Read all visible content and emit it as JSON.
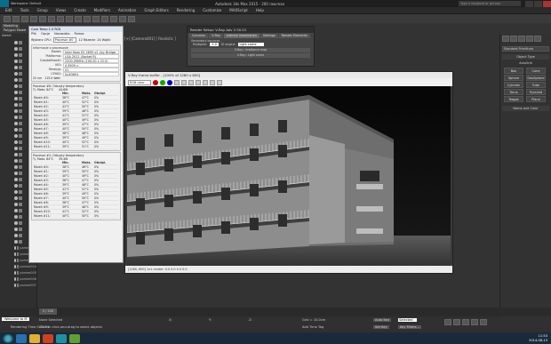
{
  "window": {
    "title": "Autodesk 3ds Max 2015 - 200  raw.max",
    "workspace": "Workspace: Default",
    "search_placeholder": "Type a keyword or phrase"
  },
  "menu": [
    "Edit",
    "Tools",
    "Group",
    "Views",
    "Create",
    "Modifiers",
    "Animation",
    "Graph Editors",
    "Rendering",
    "Customize",
    "MAXScript",
    "Help"
  ],
  "ribbon": {
    "tabs": [
      "Modeling",
      "Polygon Model"
    ],
    "select_label": "Select"
  },
  "viewport": {
    "label": "[+] [Camera001] [ Realistic ]"
  },
  "scene_objects": [
    "pamee001",
    "pamee002",
    "pamee003",
    "pamee004",
    "pamee005",
    "pamee006",
    "pamee007"
  ],
  "command_panel": {
    "dropdown": "Standard Primitives",
    "object_type": "Object Type",
    "autogrid": "AutoGrid",
    "buttons": [
      "Box",
      "Cone",
      "Sphere",
      "GeoSphere",
      "Cylinder",
      "Tube",
      "Torus",
      "Pyramid",
      "Teapot",
      "Plane"
    ],
    "name_color": "Name and Color"
  },
  "coretemp": {
    "title": "Core Temp 1.0 RC6",
    "menu": [
      "Plik",
      "Opcje",
      "Narzędzia",
      "Pomoc"
    ],
    "cpu_label": "Wybierz CPU:",
    "cpu_value": "Procesor #0",
    "cores": "12 Rdzenie",
    "threads": "24 Wątki",
    "info_header": "Informacje o procesorze",
    "fields": [
      {
        "k": "Model:",
        "v": "Intel Xeon E5 2695 v2 (Ivy Bridge-EP)"
      },
      {
        "k": "Platforma:",
        "v": "LGA 2011 (Socket R)"
      },
      {
        "k": "Częstotliwość:",
        "v": "2200.09MHz (100.00 x 22.0)"
      },
      {
        "k": "VID:",
        "v": "0.9509 v"
      },
      {
        "k": "Rewizja:",
        "v": "S1"
      },
      {
        "k": "CPUID:",
        "v": "0x306E4"
      }
    ],
    "lithography": "22 nm",
    "tdp": "115.0 Watt",
    "proc0": {
      "header": "Procesor #0: Odczyty temperatury",
      "tjmax": "Tj. Maks: 84°C",
      "power": "44.6W",
      "cols": [
        "",
        "Min.",
        "Maks.",
        "Obciąż."
      ],
      "rows": [
        [
          "Rdzeń #0:",
          "38°C",
          "47°C",
          "0%"
        ],
        [
          "Rdzeń #1:",
          "40°C",
          "52°C",
          "0%"
        ],
        [
          "Rdzeń #2:",
          "41°C",
          "50°C",
          "0%"
        ],
        [
          "Rdzeń #3:",
          "39°C",
          "48°C",
          "0%"
        ],
        [
          "Rdzeń #4:",
          "41°C",
          "51°C",
          "0%"
        ],
        [
          "Rdzeń #5:",
          "40°C",
          "49°C",
          "0%"
        ],
        [
          "Rdzeń #6:",
          "39°C",
          "47°C",
          "0%"
        ],
        [
          "Rdzeń #7:",
          "40°C",
          "50°C",
          "0%"
        ],
        [
          "Rdzeń #8:",
          "38°C",
          "48°C",
          "0%"
        ],
        [
          "Rdzeń #9:",
          "39°C",
          "49°C",
          "0%"
        ],
        [
          "Rdzeń #10:",
          "40°C",
          "52°C",
          "0%"
        ],
        [
          "Rdzeń #11:",
          "39°C",
          "51°C",
          "0%"
        ]
      ]
    },
    "proc1": {
      "header": "Procesor #1: Odczyty temperatury",
      "tjmax": "Tj. Maks: 84°C",
      "power": "39.4W",
      "cols": [
        "",
        "Min.",
        "Maks.",
        "Obciąż."
      ],
      "rows": [
        [
          "Rdzeń #0:",
          "38°C",
          "46°C",
          "0%"
        ],
        [
          "Rdzeń #1:",
          "39°C",
          "50°C",
          "0%"
        ],
        [
          "Rdzeń #2:",
          "40°C",
          "49°C",
          "0%"
        ],
        [
          "Rdzeń #3:",
          "38°C",
          "47°C",
          "0%"
        ],
        [
          "Rdzeń #4:",
          "39°C",
          "48°C",
          "0%"
        ],
        [
          "Rdzeń #5:",
          "41°C",
          "51°C",
          "0%"
        ],
        [
          "Rdzeń #6:",
          "39°C",
          "49°C",
          "0%"
        ],
        [
          "Rdzeń #7:",
          "40°C",
          "50°C",
          "0%"
        ],
        [
          "Rdzeń #8:",
          "38°C",
          "47°C",
          "0%"
        ],
        [
          "Rdzeń #9:",
          "39°C",
          "48°C",
          "0%"
        ],
        [
          "Rdzeń #10:",
          "41°C",
          "52°C",
          "0%"
        ],
        [
          "Rdzeń #11:",
          "40°C",
          "50°C",
          "0%"
        ]
      ]
    }
  },
  "render_setup": {
    "title": "Render Setup: V-Ray Adv 2.50.01",
    "tabs": [
      "Common",
      "V-Ray",
      "Indirect illumination",
      "Settings",
      "Render Elements"
    ],
    "secondary": "Secondary bounces",
    "multiplier_label": "Multiplier:",
    "multiplier": "1.0",
    "gi_engine_label": "GI engine",
    "gi_engine": "Light cache",
    "rollouts": [
      "V-Ray:: Irradiance map",
      "V-Ray:: Light cache"
    ]
  },
  "frame_buffer": {
    "title": "V-Ray frame buffer - [100% of 1280 x 800]",
    "rgb_option": "RGB color",
    "status": "[1280, 800] 1x1 render: 0.0 0.0 0.0 0.0"
  },
  "timeline": {
    "frame": "0 / 100"
  },
  "status_bar": {
    "selection": "None Selected",
    "prompt": "Click or click-and-drag to select objects",
    "welcome": "Welcome to M",
    "rendering_time": "Rendering Time 0:00:00",
    "x": "X:",
    "y": "Y:",
    "z": "Z:",
    "grid": "Grid = 10,0cm",
    "autokey": "Auto Key",
    "selected": "Selected",
    "setkey": "Set Key",
    "keyfilters": "Key Filters...",
    "addtimetag": "Add Time Tag"
  },
  "taskbar": {
    "time": "11:53",
    "date": "2014-08-13"
  }
}
